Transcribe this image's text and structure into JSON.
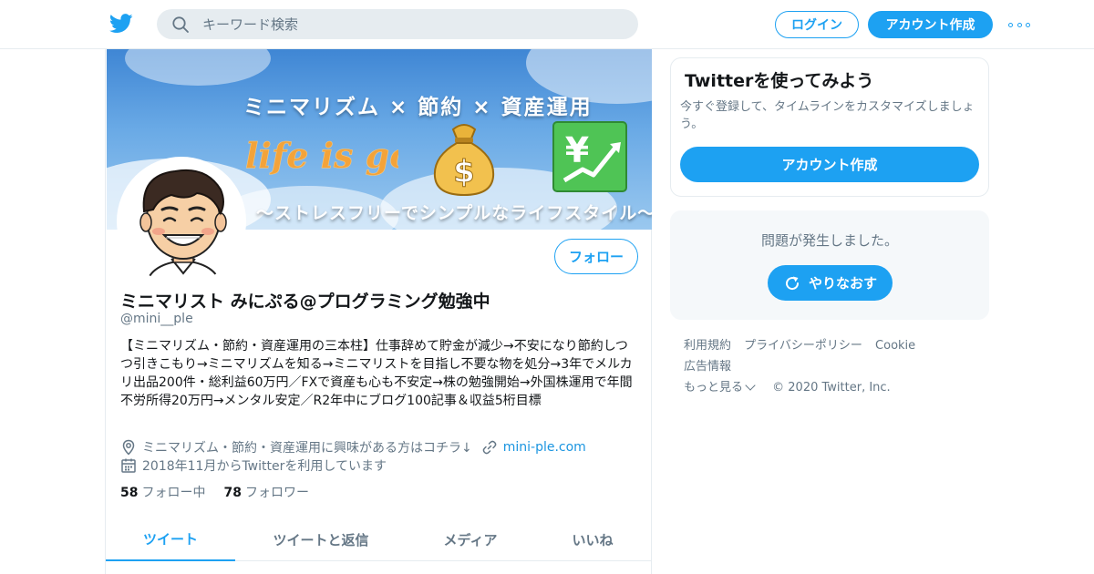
{
  "topbar": {
    "logo_icon": "twitter-bird-icon",
    "search_placeholder": "キーワード検索",
    "login_label": "ログイン",
    "signup_label": "アカウント作成",
    "more_icon": "more-dots-icon"
  },
  "banner": {
    "line1": "ミニマリズム × 節約 × 資産運用",
    "script_text": "life is good",
    "line2": "〜ストレスフリーでシンプルなライフスタイル〜"
  },
  "profile": {
    "follow_label": "フォロー",
    "name": "ミニマリスト みにぷる@プログラミング勉強中",
    "handle": "@mini__ple",
    "bio": "【ミニマリズム・節約・資産運用の三本柱】仕事辞めて貯金が減少→不安になり節約しつつ引きこもり→ミニマリズムを知る→ミニマリストを目指し不要な物を処分→3年でメルカリ出品200件・総利益60万円／FXで資産も心も不安定→株の勉強開始→外国株運用で年間不労所得20万円→メンタル安定／R2年中にブログ100記事＆収益5桁目標",
    "location": "ミニマリズム・節約・資産運用に興味がある方はコチラ↓",
    "link": "mini-ple.com",
    "joined": "2018年11月からTwitterを利用しています",
    "following_count": "58",
    "following_label": "フォロー中",
    "followers_count": "78",
    "followers_label": "フォロワー"
  },
  "tabs": [
    {
      "label": "ツイート",
      "active": true
    },
    {
      "label": "ツイートと返信",
      "active": false
    },
    {
      "label": "メディア",
      "active": false
    },
    {
      "label": "いいね",
      "active": false
    }
  ],
  "signup_card": {
    "title": "Twitterを使ってみよう",
    "desc": "今すぐ登録して、タイムラインをカスタマイズしましょう。",
    "button": "アカウント作成"
  },
  "error_card": {
    "message": "問題が発生しました。",
    "retry_label": "やりなおす"
  },
  "footer": {
    "links": [
      "利用規約",
      "プライバシーポリシー",
      "Cookie",
      "広告情報"
    ],
    "more": "もっと見る",
    "copyright": "© 2020 Twitter, Inc."
  },
  "colors": {
    "accent": "#1da1f2",
    "muted": "#657786",
    "text": "#14171a",
    "border": "#e6ecf0"
  }
}
